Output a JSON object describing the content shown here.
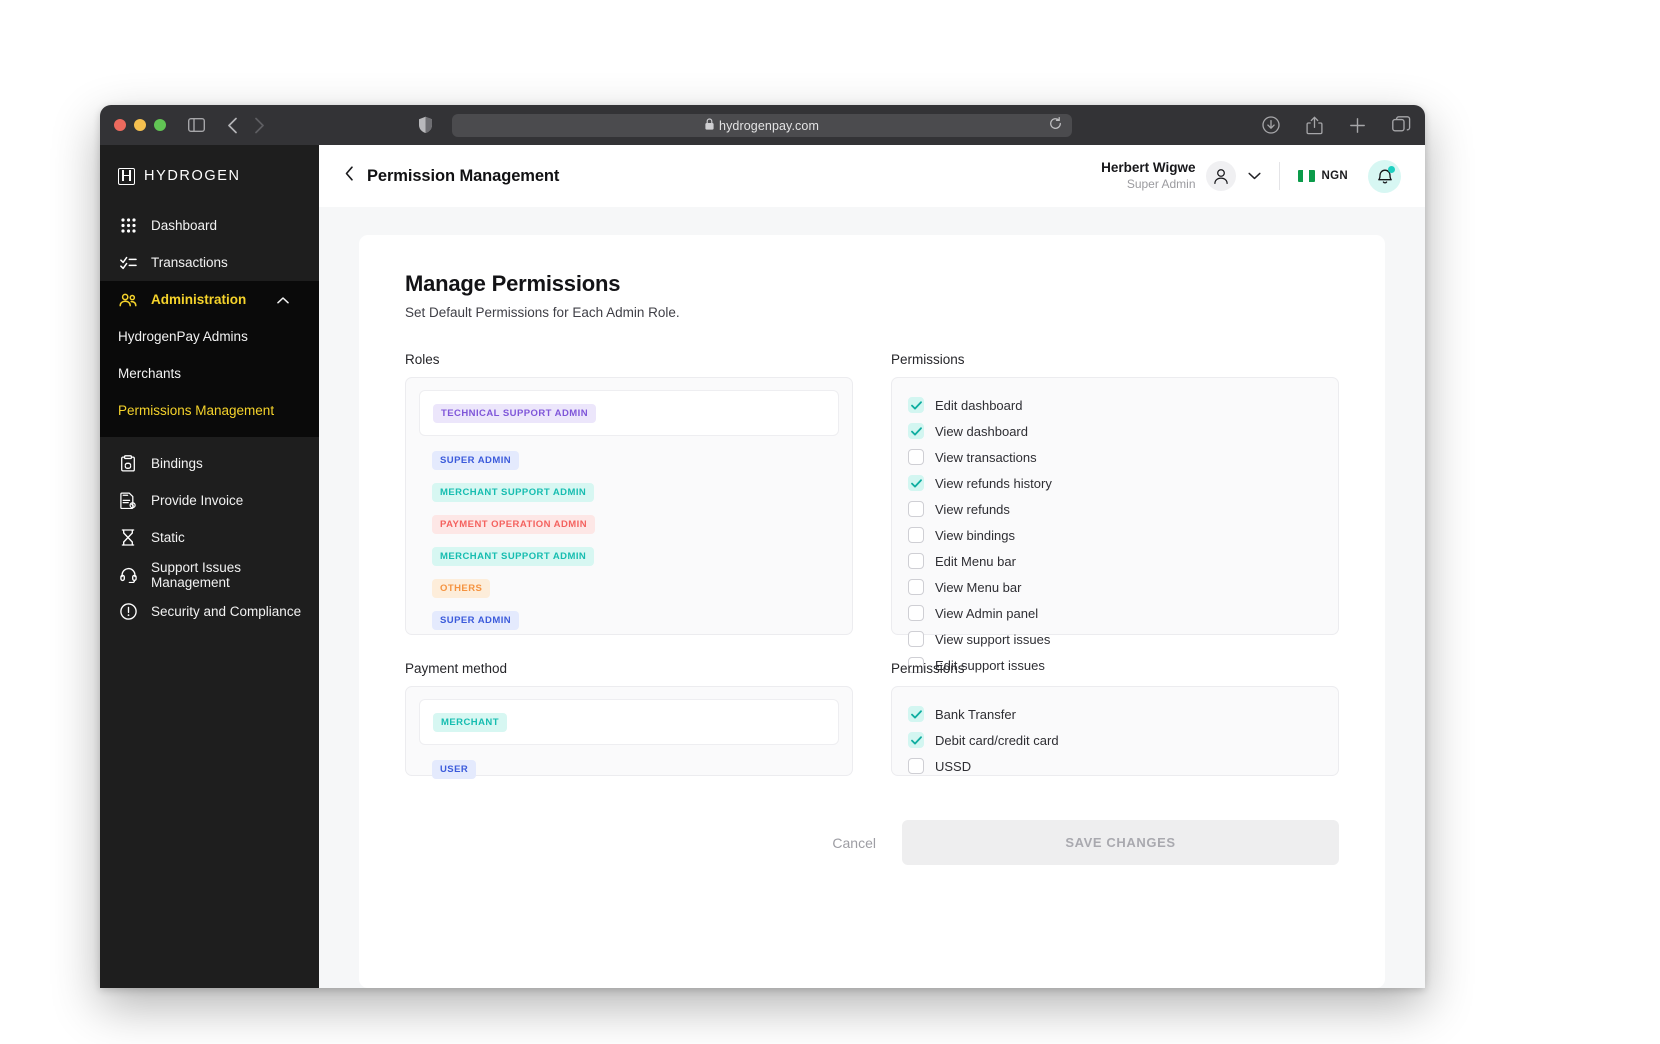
{
  "browser": {
    "url": "hydrogenpay.com",
    "lock_icon": "lock-icon",
    "traffic_lights": [
      "close",
      "minimize",
      "zoom"
    ],
    "toolbar_icons": [
      "sidebar-toggle-icon",
      "nav-back-icon",
      "nav-forward-icon",
      "shield-icon",
      "reload-icon",
      "downloads-icon",
      "share-icon",
      "new-tab-icon",
      "tab-overview-icon"
    ]
  },
  "sidebar": {
    "brand": "HYDROGEN",
    "items": [
      {
        "label": "Dashboard",
        "icon": "grid-icon"
      },
      {
        "label": "Transactions",
        "icon": "checklist-icon"
      },
      {
        "label": "Administration",
        "icon": "users-icon",
        "active": true,
        "expanded": true
      },
      {
        "label": "Bindings",
        "icon": "clipboard-link-icon"
      },
      {
        "label": "Provide Invoice",
        "icon": "invoice-icon"
      },
      {
        "label": "Static",
        "icon": "hourglass-icon"
      },
      {
        "label": "Support Issues Management",
        "icon": "headset-icon"
      },
      {
        "label": "Security and Compliance",
        "icon": "alert-shield-icon"
      }
    ],
    "sub_items": [
      {
        "label": "HydrogenPay Admins",
        "active": false
      },
      {
        "label": "Merchants",
        "active": false
      },
      {
        "label": "Permissions Management",
        "active": true
      }
    ]
  },
  "topbar": {
    "back_icon": "chevron-left-icon",
    "title": "Permission Management",
    "user_name": "Herbert Wigwe",
    "user_role": "Super Admin",
    "avatar_icon": "person-icon",
    "chevron_icon": "chevron-down-icon",
    "currency": "NGN",
    "flag_icon": "nigeria-flag-icon",
    "bell_icon": "bell-icon",
    "bell_has_badge": true
  },
  "main": {
    "title": "Manage Permissions",
    "subtitle": "Set Default Permissions for Each Admin Role.",
    "roles_label": "Roles",
    "permissions_label": "Permissions",
    "payment_method_label": "Payment method",
    "permissions2_label": "Permissions",
    "roles": [
      {
        "label": "TECHNICAL SUPPORT ADMIN",
        "color": "#7f56d9",
        "bg": "#ece6fb",
        "selected": true
      },
      {
        "label": "SUPER ADMIN",
        "color": "#3b5bdb",
        "bg": "#e4eafd",
        "selected": false
      },
      {
        "label": "MERCHANT SUPPORT ADMIN",
        "color": "#16bdb0",
        "bg": "#d7f7f2",
        "selected": false
      },
      {
        "label": "PAYMENT OPERATION ADMIN",
        "color": "#f4625f",
        "bg": "#fde7e6",
        "selected": false
      },
      {
        "label": "MERCHANT SUPPORT ADMIN",
        "color": "#16bdb0",
        "bg": "#d7f7f2",
        "selected": false
      },
      {
        "label": "OTHERS",
        "color": "#f59340",
        "bg": "#fdedda",
        "selected": false
      },
      {
        "label": "SUPER ADMIN",
        "color": "#3b5bdb",
        "bg": "#e4eafd",
        "selected": false
      }
    ],
    "permissions": [
      {
        "label": "Edit dashboard",
        "checked": true
      },
      {
        "label": "View dashboard",
        "checked": true
      },
      {
        "label": "View transactions",
        "checked": false
      },
      {
        "label": "View refunds history",
        "checked": true
      },
      {
        "label": "View refunds",
        "checked": false
      },
      {
        "label": "View bindings",
        "checked": false
      },
      {
        "label": "Edit Menu bar",
        "checked": false
      },
      {
        "label": "View Menu bar",
        "checked": false
      },
      {
        "label": "View Admin panel",
        "checked": false
      },
      {
        "label": "View support issues",
        "checked": false
      },
      {
        "label": "Edit support issues",
        "checked": false
      }
    ],
    "payment_methods": [
      {
        "label": "MERCHANT",
        "color": "#16bdb0",
        "bg": "#d7f7f2",
        "selected": true
      },
      {
        "label": "USER",
        "color": "#3b5bdb",
        "bg": "#e4eafd",
        "selected": false
      }
    ],
    "payment_permissions": [
      {
        "label": "Bank Transfer",
        "checked": true
      },
      {
        "label": "Debit card/credit card",
        "checked": true
      },
      {
        "label": "USSD",
        "checked": false
      }
    ],
    "cancel_label": "Cancel",
    "save_label": "SAVE CHANGES"
  },
  "colors": {
    "accent_teal": "#1ccfc0",
    "accent_yellow": "#f5d32b",
    "sidebar_bg": "#1e1e1e",
    "sidebar_active_bg": "#0a0a0a",
    "page_bg": "#f6f7f8"
  }
}
